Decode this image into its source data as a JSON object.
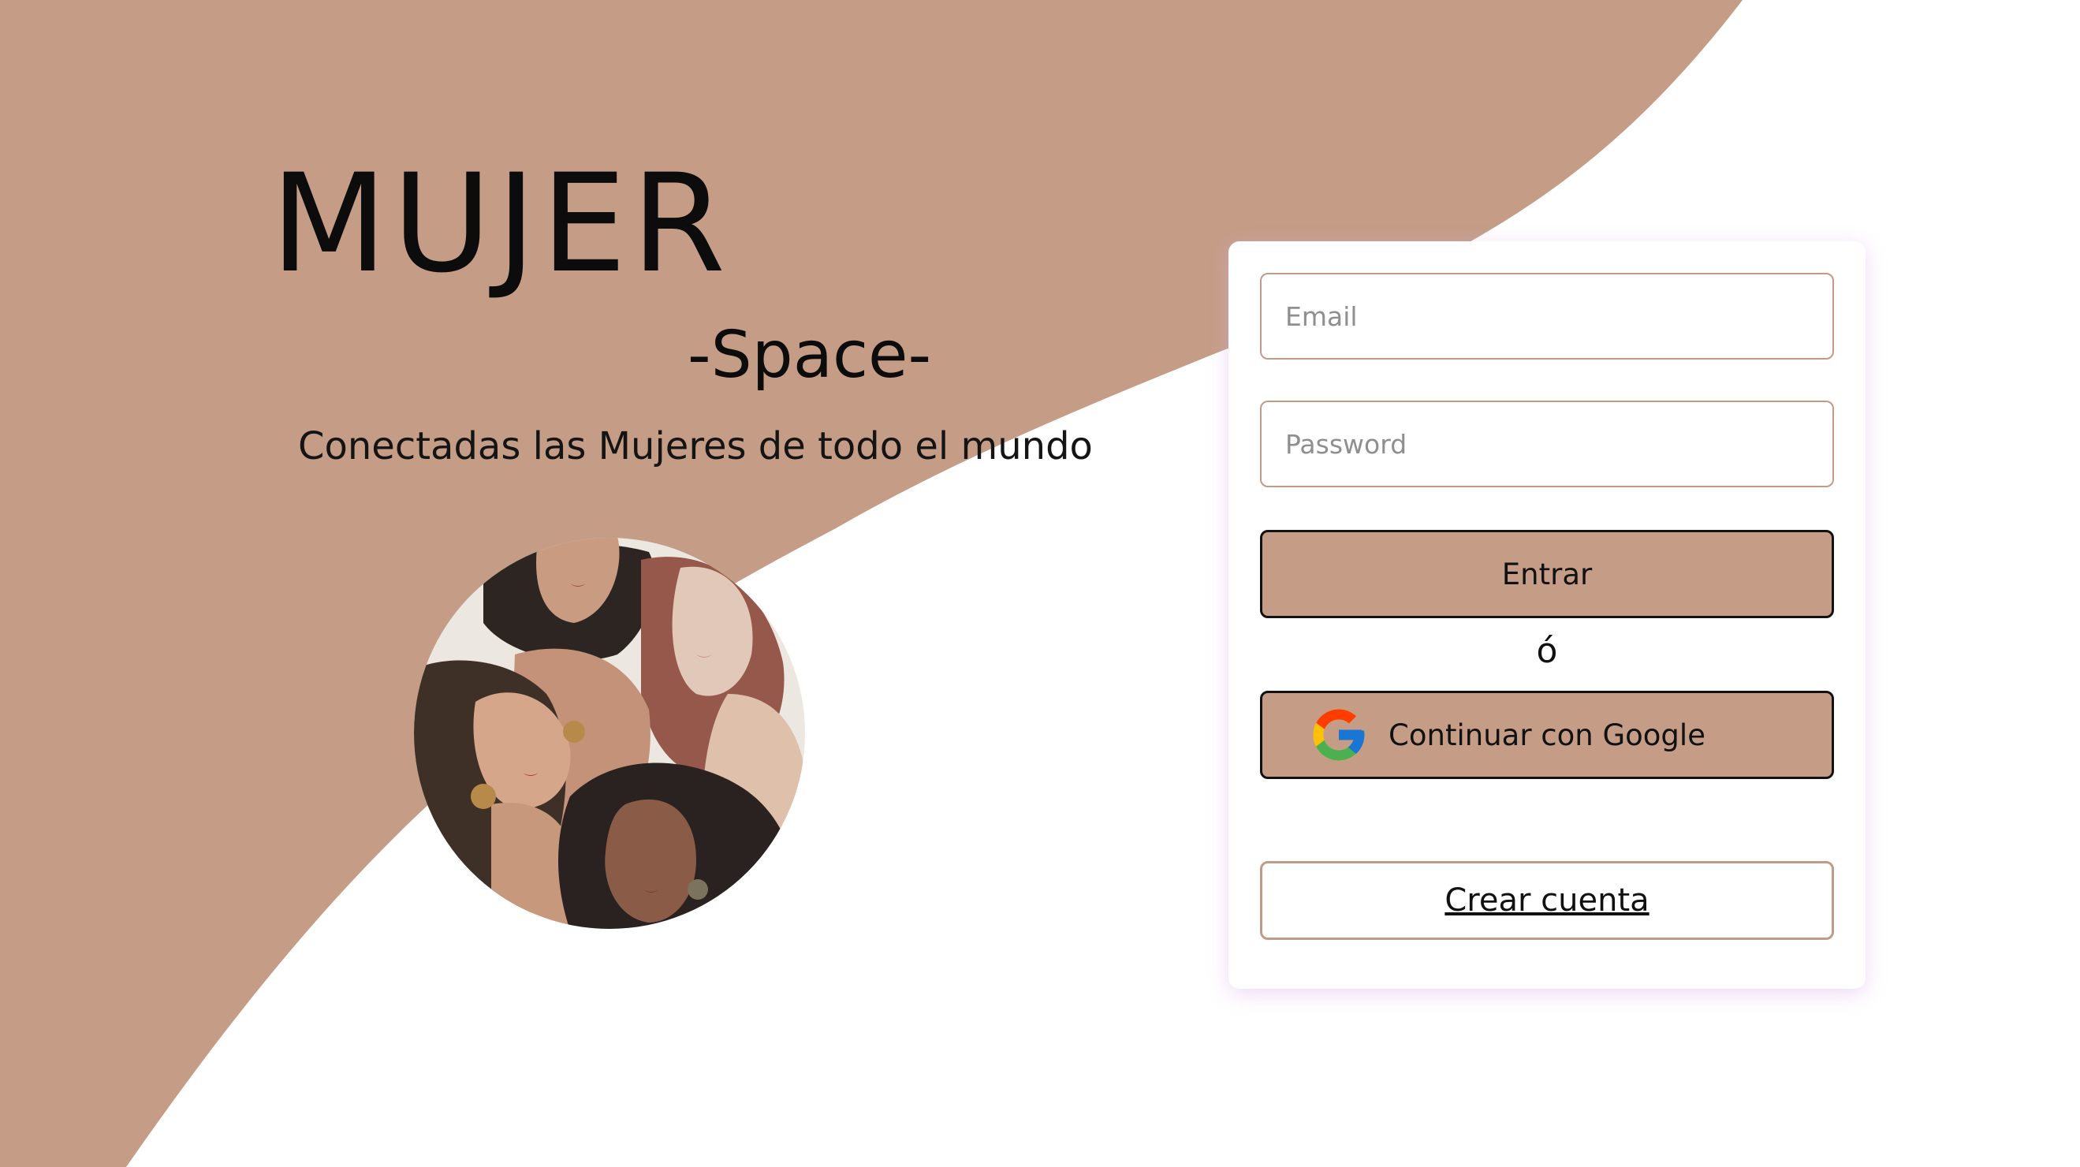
{
  "brand": {
    "title": "MUJER",
    "subtitle": "-Space-",
    "tagline": "Conectadas las Mujeres de todo el mundo"
  },
  "login": {
    "email_placeholder": "Email",
    "password_placeholder": "Password",
    "submit_label": "Entrar",
    "or_label": "ó",
    "google_label": "Continuar con Google",
    "create_account_label": "Crear cuenta"
  },
  "colors": {
    "accent": "#c59d86",
    "background": "#ffffff",
    "card_shadow": "#d6aae6"
  },
  "icons": {
    "google": "google-icon",
    "illustration": "women-group-illustration"
  }
}
